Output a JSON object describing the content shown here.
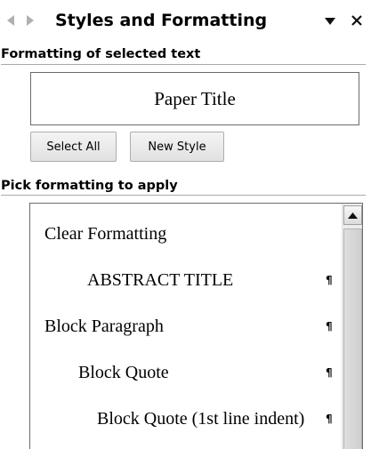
{
  "header": {
    "title": "Styles and Formatting",
    "back_icon": "arrow-left-icon",
    "forward_icon": "arrow-right-icon",
    "menu_icon": "chevron-down-icon",
    "close_icon": "close-icon"
  },
  "selected": {
    "label": "Formatting of selected text",
    "current_style": "Paper Title"
  },
  "buttons": {
    "select_all": "Select All",
    "new_style": "New Style"
  },
  "pick": {
    "label": "Pick formatting to apply",
    "items": [
      {
        "label": "Clear Formatting",
        "mark": ""
      },
      {
        "label": "ABSTRACT TITLE",
        "mark": "¶"
      },
      {
        "label": "Block Paragraph",
        "mark": "¶"
      },
      {
        "label": "Block Quote",
        "mark": "¶"
      },
      {
        "label": "Block Quote (1st line indent)",
        "mark": "¶"
      }
    ]
  },
  "colors": {
    "nav_icon": "#a8a8a8",
    "border": "#6b6b6b",
    "rule": "#aaaaaa"
  }
}
